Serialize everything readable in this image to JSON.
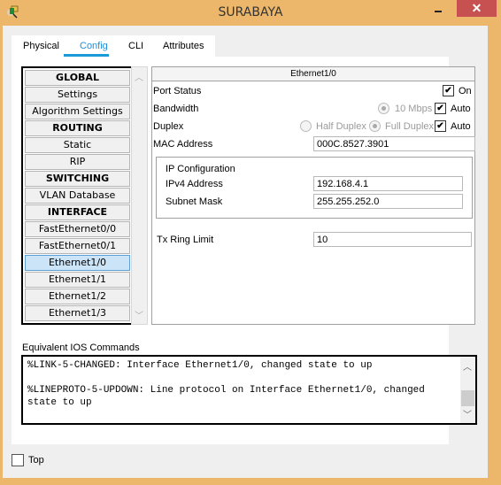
{
  "window": {
    "title": "SURABAYA",
    "close_glyph": "✕"
  },
  "tabs": [
    {
      "label": "Physical",
      "active": false
    },
    {
      "label": "Config",
      "active": true
    },
    {
      "label": "CLI",
      "active": false
    },
    {
      "label": "Attributes",
      "active": false
    }
  ],
  "sidebar": {
    "items": [
      {
        "label": "GLOBAL",
        "header": true
      },
      {
        "label": "Settings"
      },
      {
        "label": "Algorithm Settings"
      },
      {
        "label": "ROUTING",
        "header": true
      },
      {
        "label": "Static"
      },
      {
        "label": "RIP"
      },
      {
        "label": "SWITCHING",
        "header": true
      },
      {
        "label": "VLAN Database"
      },
      {
        "label": "INTERFACE",
        "header": true
      },
      {
        "label": "FastEthernet0/0"
      },
      {
        "label": "FastEthernet0/1"
      },
      {
        "label": "Ethernet1/0",
        "selected": true
      },
      {
        "label": "Ethernet1/1"
      },
      {
        "label": "Ethernet1/2"
      },
      {
        "label": "Ethernet1/3"
      }
    ]
  },
  "interface": {
    "title": "Ethernet1/0",
    "port_status": {
      "label": "Port Status",
      "on_label": "On",
      "checked": true
    },
    "bandwidth": {
      "label": "Bandwidth",
      "option": "10 Mbps",
      "auto_label": "Auto",
      "auto": true
    },
    "duplex": {
      "label": "Duplex",
      "half": "Half Duplex",
      "full": "Full Duplex",
      "auto_label": "Auto",
      "auto": true
    },
    "mac": {
      "label": "MAC Address",
      "value": "000C.8527.3901"
    },
    "ip_config": {
      "title": "IP Configuration",
      "ipv4_label": "IPv4 Address",
      "ipv4": "192.168.4.1",
      "mask_label": "Subnet Mask",
      "mask": "255.255.252.0"
    },
    "tx_ring": {
      "label": "Tx Ring Limit",
      "value": "10"
    }
  },
  "ios": {
    "label": "Equivalent IOS Commands",
    "text": "%LINK-5-CHANGED: Interface Ethernet1/0, changed state to up\n\n%LINEPROTO-5-UPDOWN: Line protocol on Interface Ethernet1/0, changed\nstate to up"
  },
  "top": {
    "label": "Top",
    "checked": false
  }
}
